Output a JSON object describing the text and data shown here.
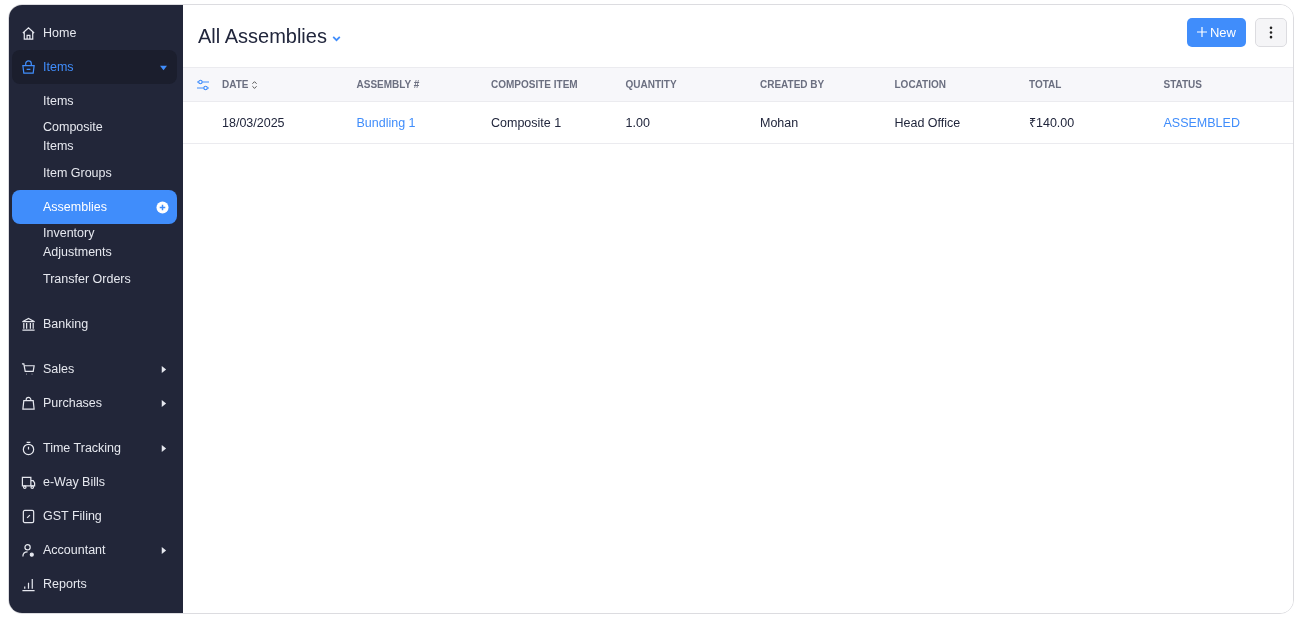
{
  "sidebar": {
    "groups": [
      [
        {
          "label": "Home",
          "selected": false
        },
        {
          "label": "Items",
          "selected": true,
          "expanded": true,
          "children": [
            {
              "label": "Items",
              "selected": false
            },
            {
              "label": "Composite Items",
              "selected": false
            },
            {
              "label": "Item Groups",
              "selected": false
            },
            {
              "label": "Assemblies",
              "selected": true
            },
            {
              "label": "Inventory Adjustments",
              "selected": false
            },
            {
              "label": "Transfer Orders",
              "selected": false
            }
          ]
        }
      ],
      [
        {
          "label": "Banking",
          "selected": false
        }
      ],
      [
        {
          "label": "Sales",
          "selected": false,
          "expanded": false
        },
        {
          "label": "Purchases",
          "selected": false,
          "expanded": false
        }
      ],
      [
        {
          "label": "Time Tracking",
          "selected": false,
          "expanded": false
        },
        {
          "label": "e-Way Bills",
          "selected": false
        },
        {
          "label": "GST Filing",
          "selected": false
        },
        {
          "label": "Accountant",
          "selected": false,
          "expanded": false
        },
        {
          "label": "Reports",
          "selected": false
        }
      ]
    ]
  },
  "header": {
    "title": "All Assemblies",
    "new_button": "New"
  },
  "table": {
    "columns": [
      {
        "label": "DATE",
        "sortable": true
      },
      {
        "label": "ASSEMBLY #",
        "sortable": false
      },
      {
        "label": "COMPOSITE ITEM",
        "sortable": false
      },
      {
        "label": "QUANTITY",
        "sortable": false
      },
      {
        "label": "CREATED BY",
        "sortable": false
      },
      {
        "label": "LOCATION",
        "sortable": false
      },
      {
        "label": "TOTAL",
        "sortable": false
      },
      {
        "label": "STATUS",
        "sortable": false
      }
    ],
    "rows": [
      {
        "cells": [
          {
            "text": "18/03/2025",
            "kind": "text"
          },
          {
            "text": "Bundling 1",
            "kind": "link"
          },
          {
            "text": "Composite 1",
            "kind": "text"
          },
          {
            "text": "1.00",
            "kind": "text"
          },
          {
            "text": "Mohan",
            "kind": "text"
          },
          {
            "text": "Head Office",
            "kind": "text"
          },
          {
            "text": "₹140.00",
            "kind": "text"
          },
          {
            "text": "ASSEMBLED",
            "kind": "status",
            "color": "#408dfb"
          }
        ]
      }
    ]
  }
}
